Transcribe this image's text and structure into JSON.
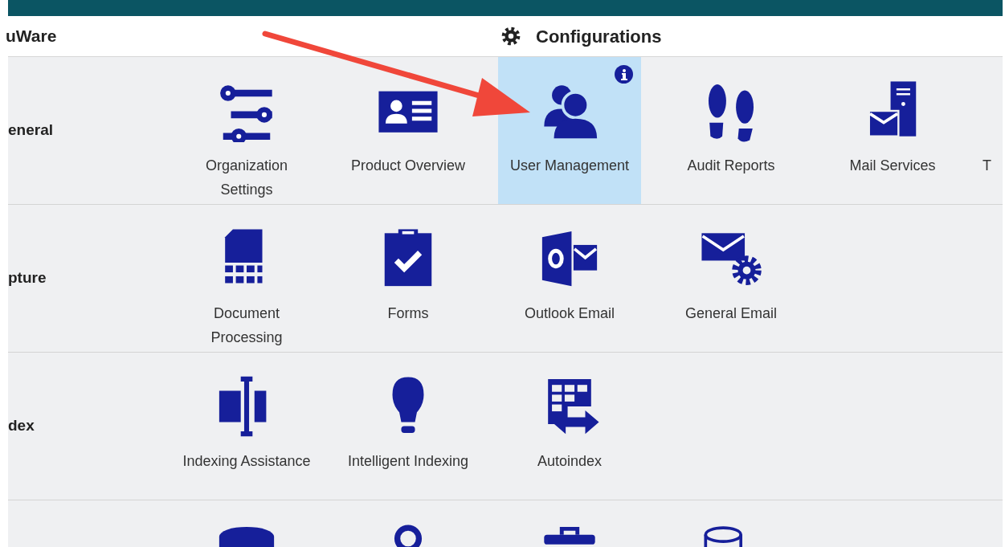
{
  "header": {
    "app_name": "uWare",
    "title": "Configurations"
  },
  "sections": [
    {
      "label": "eneral",
      "items": [
        {
          "label": "Organization Settings",
          "kind": "sliders",
          "selected": false
        },
        {
          "label": "Product Overview",
          "kind": "idcard",
          "selected": false
        },
        {
          "label": "User Management",
          "kind": "users",
          "selected": true,
          "info": true
        },
        {
          "label": "Audit Reports",
          "kind": "footprints",
          "selected": false
        },
        {
          "label": "Mail Services",
          "kind": "mailserver",
          "selected": false
        },
        {
          "label": "T",
          "selected": false
        }
      ]
    },
    {
      "label": "pture",
      "items": [
        {
          "label": "Document Processing",
          "kind": "docgrid",
          "selected": false
        },
        {
          "label": "Forms",
          "kind": "clipboard",
          "selected": false
        },
        {
          "label": "Outlook Email",
          "kind": "outlook",
          "selected": false
        },
        {
          "label": "General Email",
          "kind": "mailgear",
          "selected": false
        }
      ]
    },
    {
      "label": "dex",
      "items": [
        {
          "label": "Indexing Assistance",
          "kind": "textcursor",
          "selected": false
        },
        {
          "label": "Intelligent Indexing",
          "kind": "bulb",
          "selected": false
        },
        {
          "label": "Autoindex",
          "kind": "tablearrows",
          "selected": false
        }
      ]
    },
    {
      "items": [
        {
          "kind": "cylinder",
          "selected": false
        },
        {
          "kind": "pin",
          "selected": false
        },
        {
          "kind": "toolbox",
          "selected": false
        },
        {
          "kind": "dbarrow",
          "selected": false
        }
      ]
    }
  ]
}
